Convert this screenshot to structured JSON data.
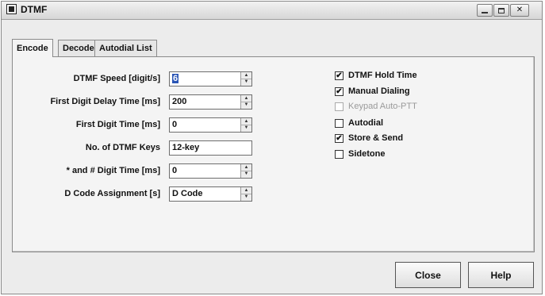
{
  "window": {
    "title": "DTMF"
  },
  "tabs": [
    "Encode",
    "Decode",
    "Autodial List"
  ],
  "fields": [
    {
      "label": "DTMF Speed [digit/s]",
      "value": "6",
      "type": "spin"
    },
    {
      "label": "First Digit Delay Time [ms]",
      "value": "200",
      "type": "spin"
    },
    {
      "label": "First Digit Time [ms]",
      "value": "0",
      "type": "spin"
    },
    {
      "label": "No. of DTMF Keys",
      "value": "12-key",
      "type": "text"
    },
    {
      "label": "* and # Digit Time [ms]",
      "value": "0",
      "type": "spin"
    },
    {
      "label": "D Code Assignment [s]",
      "value": "D Code",
      "type": "spin"
    }
  ],
  "checks": [
    {
      "label": "DTMF Hold Time",
      "checked": true,
      "enabled": true
    },
    {
      "label": "Manual Dialing",
      "checked": true,
      "enabled": true
    },
    {
      "label": "Keypad Auto-PTT",
      "checked": false,
      "enabled": false
    },
    {
      "label": "Autodial",
      "checked": false,
      "enabled": true
    },
    {
      "label": "Store & Send",
      "checked": true,
      "enabled": true
    },
    {
      "label": "Sidetone",
      "checked": false,
      "enabled": true
    }
  ],
  "buttons": {
    "close": "Close",
    "help": "Help"
  },
  "icons": {
    "app": "dtmf-app-icon",
    "check_mark": "✔"
  }
}
